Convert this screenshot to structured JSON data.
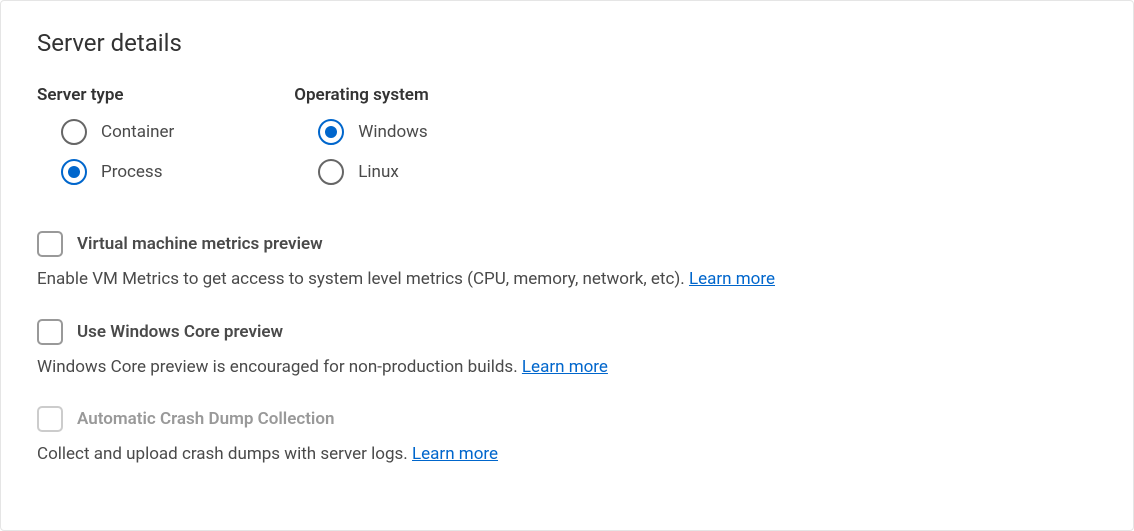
{
  "section_title": "Server details",
  "server_type": {
    "label": "Server type",
    "options": {
      "container": "Container",
      "process": "Process"
    },
    "selected": "process"
  },
  "operating_system": {
    "label": "Operating system",
    "options": {
      "windows": "Windows",
      "linux": "Linux"
    },
    "selected": "windows"
  },
  "checkboxes": {
    "vm_metrics": {
      "label": "Virtual machine metrics preview",
      "description": "Enable VM Metrics to get access to system level metrics (CPU, memory, network, etc). ",
      "learn_more": "Learn more",
      "checked": false,
      "disabled": false
    },
    "windows_core": {
      "label": "Use Windows Core preview",
      "description": "Windows Core preview is encouraged for non-production builds. ",
      "learn_more": "Learn more",
      "checked": false,
      "disabled": false
    },
    "crash_dump": {
      "label": "Automatic Crash Dump Collection",
      "description": "Collect and upload crash dumps with server logs. ",
      "learn_more": "Learn more",
      "checked": false,
      "disabled": true
    }
  }
}
